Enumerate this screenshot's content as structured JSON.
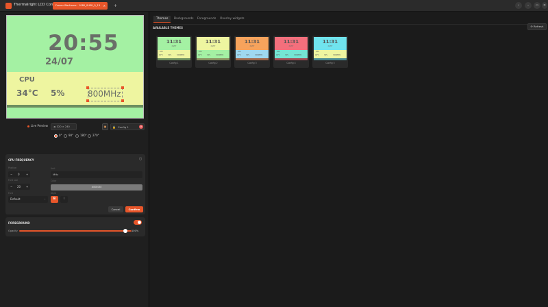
{
  "app": {
    "title": "Thermalright LCD Control",
    "device_tab": "Frozen Warframe  ·  1080_0HSK_0_13",
    "add_tab": "+",
    "window_buttons": [
      "‹",
      "–",
      "▭",
      "✕"
    ]
  },
  "lcd": {
    "time": "20:55",
    "date": "24/07",
    "cpu_label": "CPU",
    "temperature": "34°C",
    "load": "5%",
    "frequency": "800MHz",
    "colors": {
      "top": "#a4f1a3",
      "middle": "#eef5a0",
      "bar": "#6d8f5f"
    }
  },
  "preview": {
    "live_label": "Live Preview",
    "resolution": "◂▸  320  ×  240",
    "save_icon": "floppy-icon",
    "config_name": "Config 1"
  },
  "rotation": {
    "options": [
      "0°",
      "90°",
      "180°",
      "270°"
    ],
    "selected": "0°"
  },
  "cpu_panel": {
    "title": "CPU FREQUENCY",
    "label_position": "Position",
    "position_value": "0",
    "label_font_size": "Font size",
    "font_size_value": "20",
    "label_font": "Font",
    "font_value": "Default",
    "label_unit": "Unit",
    "unit_value": "MHz",
    "label_color": "Color",
    "color_value": "#808080",
    "label_style": "Style",
    "bold_label": "B",
    "italic_label": "I",
    "cancel_label": "Cancel",
    "confirm_label": "Confirm"
  },
  "foreground_panel": {
    "title": "FOREGROUND",
    "opacity_label": "Opacity",
    "opacity_value": "100%",
    "enabled": true
  },
  "right": {
    "tabs": [
      "Themes",
      "Backgrounds",
      "Foregrounds",
      "Overlay widgets"
    ],
    "active_tab": "Themes",
    "section_label": "AVAILABLE THEMES",
    "refresh_label": "⟳ Refresh",
    "themes": [
      {
        "label": "Config 1",
        "top": "#a4f1a3",
        "mid": "#eef5a0",
        "bar": "#6d8f5f",
        "time": "11:31",
        "date": "24/07",
        "cpu": "CPU",
        "temp": "40°C",
        "load": "34%",
        "freq": "3200MHz"
      },
      {
        "label": "Config 2",
        "top": "#eef5a0",
        "mid": "#a4f1a3",
        "bar": "#8a8f5f",
        "time": "11:31",
        "date": "24/07",
        "cpu": "CPU",
        "temp": "40°C",
        "load": "34%",
        "freq": "3200MHz"
      },
      {
        "label": "Config 3",
        "top": "#f6a35c",
        "mid": "#9fd8f0",
        "bar": "#a0664a",
        "time": "11:31",
        "date": "24/07",
        "cpu": "CPU",
        "temp": "40°C",
        "load": "34%",
        "freq": "3200MHz"
      },
      {
        "label": "Config 4",
        "top": "#f36f7c",
        "mid": "#74e5d4",
        "bar": "#a04a52",
        "time": "11:31",
        "date": "24/07",
        "cpu": "CPU",
        "temp": "40°C",
        "load": "34%",
        "freq": "3200MHz"
      },
      {
        "label": "Config 5",
        "top": "#70e4ee",
        "mid": "#eef5a0",
        "bar": "#4a8a92",
        "time": "11:31",
        "date": "24/07",
        "cpu": "CPU",
        "temp": "40°C",
        "load": "34%",
        "freq": "3200MHz"
      }
    ]
  }
}
